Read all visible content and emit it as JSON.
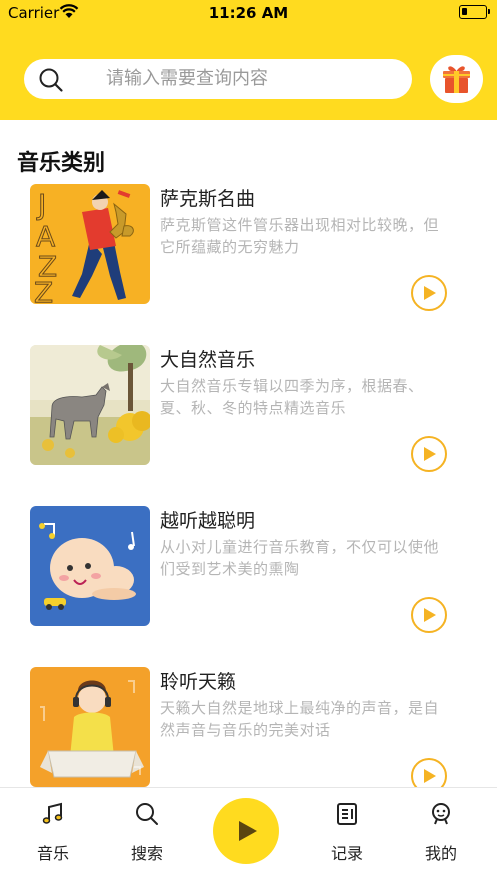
{
  "status_bar": {
    "carrier": "Carrier",
    "time": "11:26 AM"
  },
  "search": {
    "placeholder": "请输入需要查询内容"
  },
  "section": {
    "title": "音乐类别"
  },
  "items": [
    {
      "title": "萨克斯名曲",
      "desc": "萨克斯管这件管乐器出现相对比较晚，但它所蕴藏的无穷魅力"
    },
    {
      "title": "大自然音乐",
      "desc": "大自然音乐专辑以四季为序，根据春、夏、秋、冬的特点精选音乐"
    },
    {
      "title": "越听越聪明",
      "desc": "从小对儿童进行音乐教育，不仅可以使他们受到艺术美的熏陶"
    },
    {
      "title": "聆听天籁",
      "desc": "天籁大自然是地球上最纯净的声音，是自然声音与音乐的完美对话"
    }
  ],
  "tabbar": {
    "music": "音乐",
    "search": "搜索",
    "records": "记录",
    "mine": "我的"
  },
  "colors": {
    "accent": "#FFDB1F",
    "play_ring": "#F5B323",
    "play_icon": "#F5B323"
  },
  "icons": {
    "search": "search-icon",
    "gift": "gift-icon",
    "play": "play-icon",
    "music": "music-note-icon",
    "records": "document-icon",
    "mine": "smiley-icon"
  }
}
